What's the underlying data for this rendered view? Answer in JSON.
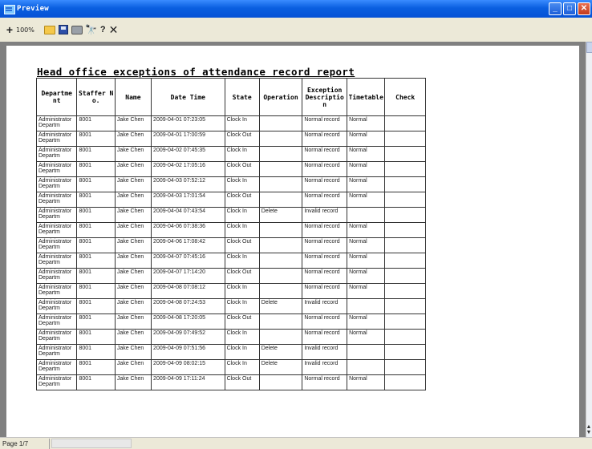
{
  "window": {
    "title": "Preview"
  },
  "toolbar": {
    "zoom_label": "100%"
  },
  "report": {
    "title": "Head office exceptions of attendance record report",
    "columns": [
      "Departme nt",
      "Staffer No.",
      "Name",
      "Date Time",
      "State",
      "Operation",
      "Exception Description",
      "Timetable",
      "Check"
    ],
    "rows": [
      [
        "Administrator Departm",
        "8001",
        "Jake Chen",
        "2009-04-01 07:23:05",
        "Clock In",
        "",
        "Normal record",
        "Normal",
        ""
      ],
      [
        "Administrator Departm",
        "8001",
        "Jake Chen",
        "2009-04-01 17:00:59",
        "Clock Out",
        "",
        "Normal record",
        "Normal",
        ""
      ],
      [
        "Administrator Departm",
        "8001",
        "Jake Chen",
        "2009-04-02 07:45:35",
        "Clock In",
        "",
        "Normal record",
        "Normal",
        ""
      ],
      [
        "Administrator Departm",
        "8001",
        "Jake Chen",
        "2009-04-02 17:05:16",
        "Clock Out",
        "",
        "Normal record",
        "Normal",
        ""
      ],
      [
        "Administrator Departm",
        "8001",
        "Jake Chen",
        "2009-04-03 07:52:12",
        "Clock In",
        "",
        "Normal record",
        "Normal",
        ""
      ],
      [
        "Administrator Departm",
        "8001",
        "Jake Chen",
        "2009-04-03 17:01:54",
        "Clock Out",
        "",
        "Normal record",
        "Normal",
        ""
      ],
      [
        "Administrator Departm",
        "8001",
        "Jake Chen",
        "2009-04-04 07:43:54",
        "Clock In",
        "Delete",
        "Invalid record",
        "",
        ""
      ],
      [
        "Administrator Departm",
        "8001",
        "Jake Chen",
        "2009-04-06 07:38:36",
        "Clock In",
        "",
        "Normal record",
        "Normal",
        ""
      ],
      [
        "Administrator Departm",
        "8001",
        "Jake Chen",
        "2009-04-06 17:08:42",
        "Clock Out",
        "",
        "Normal record",
        "Normal",
        ""
      ],
      [
        "Administrator Departm",
        "8001",
        "Jake Chen",
        "2009-04-07 07:45:16",
        "Clock In",
        "",
        "Normal record",
        "Normal",
        ""
      ],
      [
        "Administrator Departm",
        "8001",
        "Jake Chen",
        "2009-04-07 17:14:20",
        "Clock Out",
        "",
        "Normal record",
        "Normal",
        ""
      ],
      [
        "Administrator Departm",
        "8001",
        "Jake Chen",
        "2009-04-08 07:08:12",
        "Clock In",
        "",
        "Normal record",
        "Normal",
        ""
      ],
      [
        "Administrator Departm",
        "8001",
        "Jake Chen",
        "2009-04-08 07:24:53",
        "Clock In",
        "Delete",
        "Invalid record",
        "",
        ""
      ],
      [
        "Administrator Departm",
        "8001",
        "Jake Chen",
        "2009-04-08 17:20:05",
        "Clock Out",
        "",
        "Normal record",
        "Normal",
        ""
      ],
      [
        "Administrator Departm",
        "8001",
        "Jake Chen",
        "2009-04-09 07:49:52",
        "Clock In",
        "",
        "Normal record",
        "Normal",
        ""
      ],
      [
        "Administrator Departm",
        "8001",
        "Jake Chen",
        "2009-04-09 07:51:56",
        "Clock In",
        "Delete",
        "Invalid record",
        "",
        ""
      ],
      [
        "Administrator Departm",
        "8001",
        "Jake Chen",
        "2009-04-09 08:02:15",
        "Clock In",
        "Delete",
        "Invalid record",
        "",
        ""
      ],
      [
        "Administrator Departm",
        "8001",
        "Jake Chen",
        "2009-04-09 17:11:24",
        "Clock Out",
        "",
        "Normal record",
        "Normal",
        ""
      ]
    ]
  },
  "statusbar": {
    "page": "Page 1/7"
  }
}
